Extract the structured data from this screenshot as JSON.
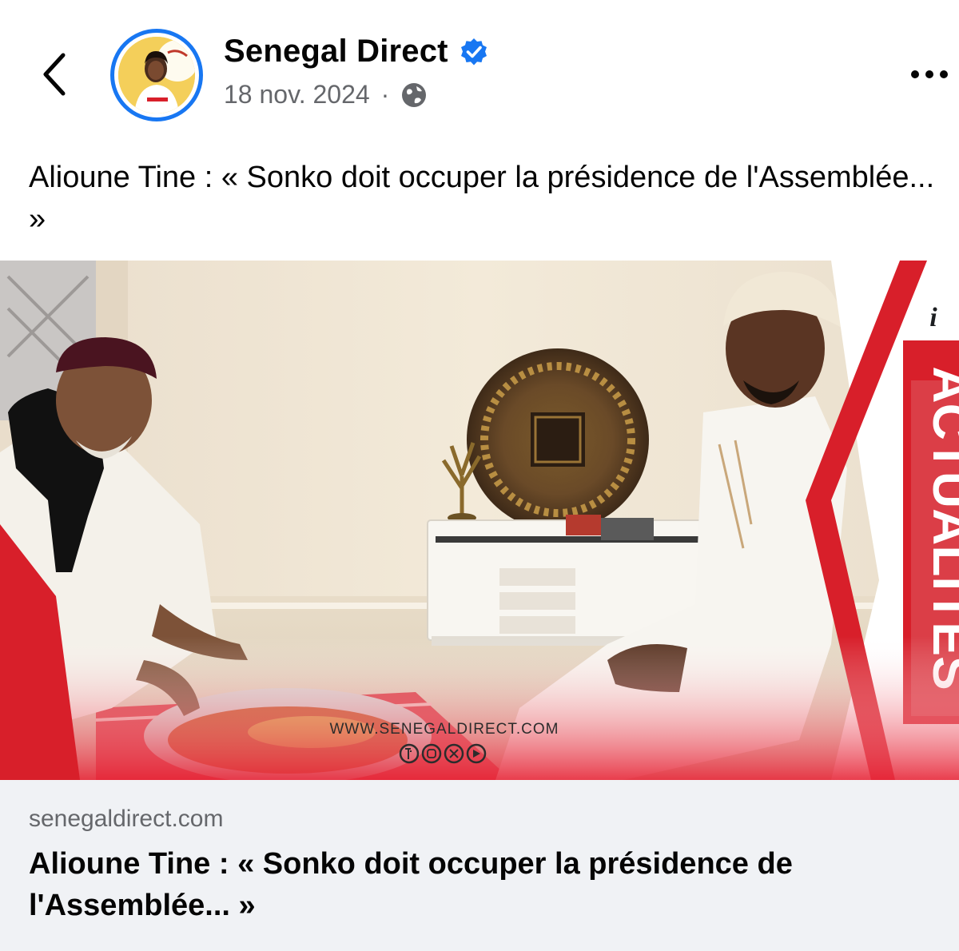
{
  "header": {
    "page_name": "Senegal Direct",
    "date": "18 nov. 2024",
    "separator": "·",
    "verified": true,
    "icons": {
      "back": "chevron-left-icon",
      "verified": "verified-badge-icon",
      "audience": "globe-icon",
      "more": "more-horizontal-icon"
    }
  },
  "post": {
    "text": "Alioune Tine : « Sonko doit occuper la présidence de l'Assemblée... »"
  },
  "media": {
    "banner_text": "ACTUALITES",
    "watermark": "WWW.SENEGALDIRECT.COM",
    "info_label": "i",
    "social_icons": [
      "facebook-icon",
      "instagram-icon",
      "x-icon",
      "youtube-icon"
    ]
  },
  "link_preview": {
    "domain": "senegaldirect.com",
    "title": "Alioune Tine : « Sonko doit occuper la présidence de l'Assemblée... »"
  },
  "colors": {
    "verified_blue": "#1877f2",
    "banner_red": "#d81f2a",
    "meta_gray": "#65676b",
    "preview_bg": "#f0f2f5"
  }
}
